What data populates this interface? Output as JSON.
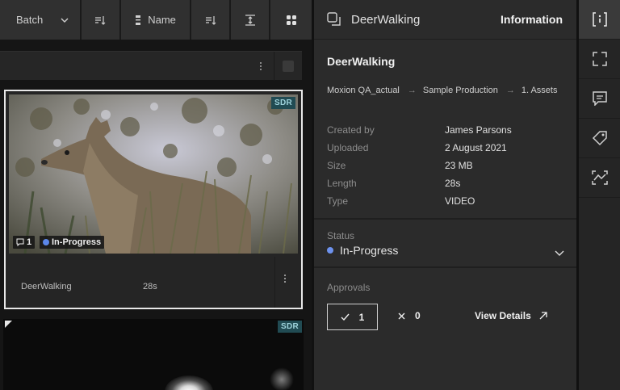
{
  "toolbar": {
    "batch_label": "Batch",
    "name_label": "Name",
    "icons": [
      "chevron-down-icon",
      "sort-icon",
      "name-sort-icon",
      "sort-order-icon",
      "fit-icon",
      "grid-icon"
    ]
  },
  "cards": [
    {
      "badge": "SDR",
      "comments": "1",
      "status": "In-Progress",
      "name": "DeerWalking",
      "length": "28s",
      "status_color": "#5b87e8"
    },
    {
      "badge": "SDR"
    }
  ],
  "panel": {
    "title": "DeerWalking",
    "tab": "Information",
    "asset_name": "DeerWalking",
    "breadcrumb": [
      "Moxion QA_actual",
      "Sample Production",
      "1. Assets"
    ],
    "properties": [
      {
        "key": "Created by",
        "value": "James Parsons"
      },
      {
        "key": "Uploaded",
        "value": "2 August 2021"
      },
      {
        "key": "Size",
        "value": "23 MB"
      },
      {
        "key": "Length",
        "value": "28s"
      },
      {
        "key": "Type",
        "value": "VIDEO"
      }
    ],
    "status_label": "Status",
    "status_value": "In-Progress",
    "approvals_label": "Approvals",
    "approved_count": "1",
    "rejected_count": "0",
    "view_details": "View Details"
  },
  "rail": {
    "icons": [
      "info-icon",
      "crop-icon",
      "comment-icon",
      "tag-icon",
      "compare-icon"
    ],
    "active": "info-icon"
  },
  "colors": {
    "accent_blue": "#6d92ee",
    "badge_bg": "#214b53",
    "panel_bg": "#2b2b2b"
  }
}
